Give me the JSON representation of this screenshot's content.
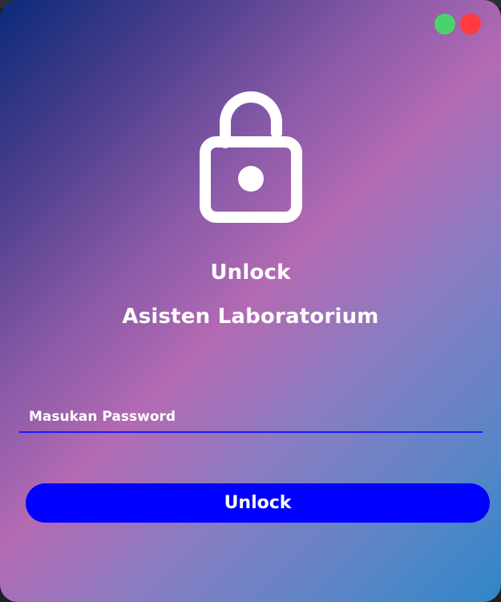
{
  "window": {
    "controls": {
      "green_color": "#4bd36b",
      "red_color": "#ff3b3b"
    }
  },
  "icons": {
    "lock": "unlock-icon"
  },
  "headings": {
    "line1": "Unlock",
    "line2": "Asisten Laboratorium"
  },
  "password_input": {
    "placeholder": "Masukan Password",
    "value": ""
  },
  "buttons": {
    "unlock_label": "Unlock"
  },
  "colors": {
    "accent_blue": "#0000ff",
    "underline_blue": "#1a1aff",
    "gradient_start": "#0b2a7a",
    "gradient_mid": "#b36ab3",
    "gradient_end": "#2f86c8"
  }
}
